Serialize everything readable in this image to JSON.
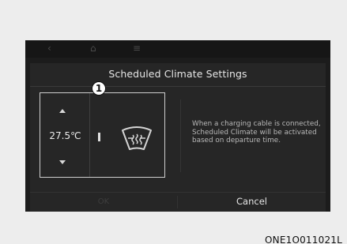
{
  "topbar": {
    "back_icon": "‹",
    "home_icon": "⌂",
    "menu_icon": "≡"
  },
  "dialog": {
    "title": "Scheduled Climate Settings",
    "callout_number": "1",
    "temperature": "27.5℃",
    "info_text": "When a charging cable is connected, Scheduled Climate will be activated based on departure time.",
    "ok_label": "OK",
    "cancel_label": "Cancel"
  },
  "image_code": "ONE1O011021L",
  "icons": [
    "back-icon",
    "home-icon",
    "menu-icon",
    "arrow-up-icon",
    "arrow-down-icon",
    "front-defrost-icon"
  ],
  "colors": {
    "screen_bg": "#1c1c1c",
    "dialog_bg": "#262626",
    "text_primary": "#e6e6e6",
    "text_secondary": "#b8b8b8"
  }
}
